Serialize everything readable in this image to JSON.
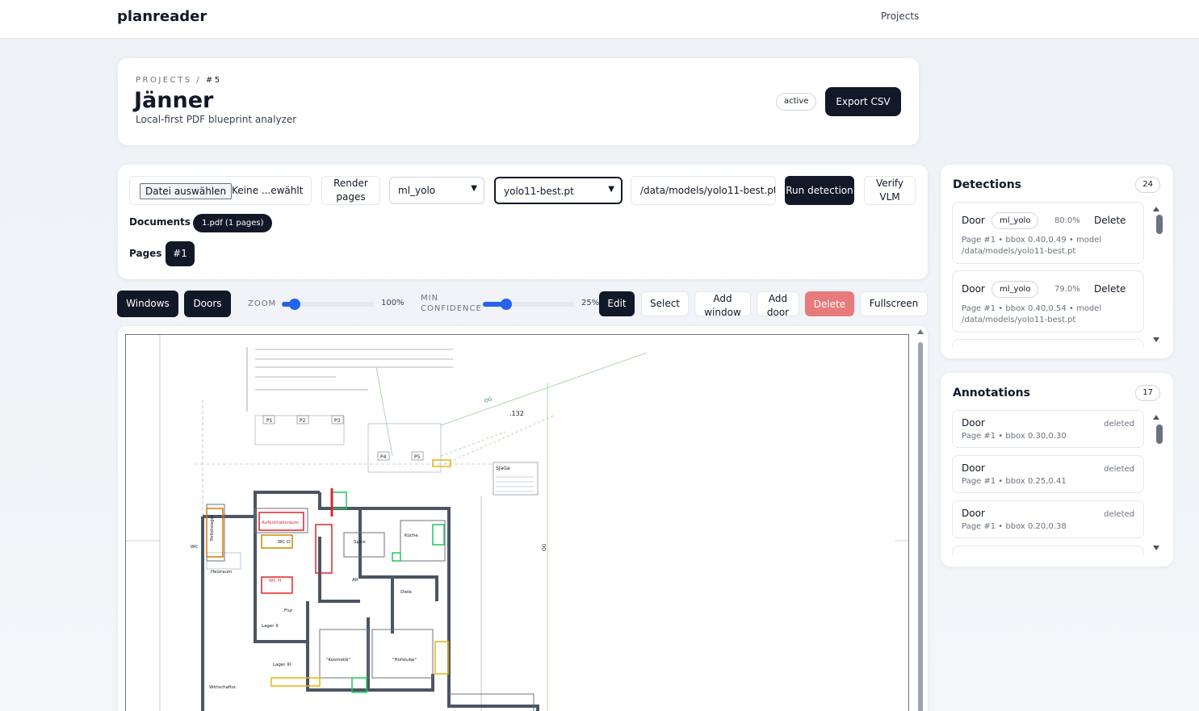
{
  "app": {
    "brand": "planreader",
    "nav_projects": "Projects"
  },
  "breadcrumb": {
    "root": "PROJECTS",
    "separator": "/",
    "current": "#5"
  },
  "project": {
    "title": "Jänner",
    "subtitle": "Local-first PDF blueprint analyzer",
    "status": "active",
    "export_label": "Export CSV"
  },
  "toolbar": {
    "file_button": "Datei auswählen",
    "file_name": "Keine ...ewählt",
    "render_label": "Render pages",
    "detector_value": "ml_yolo",
    "model_value": "yolo11-best.pt",
    "model_path": "/data/models/yolo11-best.pt",
    "run_label": "Run detection",
    "verify_label": "Verify VLM",
    "documents_label": "Documents",
    "document_pill": "1.pdf (1 pages)",
    "pages_label": "Pages",
    "page_pill": "#1"
  },
  "controls": {
    "windows_label": "Windows",
    "doors_label": "Doors",
    "zoom_label": "ZOOM",
    "zoom_value": 100,
    "zoom_text": "100%",
    "min_conf_label": "MIN CONFIDENCE",
    "min_conf_value": 25,
    "min_conf_text": "25%",
    "edit_label": "Edit",
    "select_label": "Select",
    "add_window_label": "Add window",
    "add_door_label": "Add door",
    "delete_label": "Delete",
    "fullscreen_label": "Fullscreen"
  },
  "blueprint": {
    "number_label": ".132",
    "label_og": "OG",
    "room_p1": "P1",
    "room_p2": "P2",
    "room_p3": "P3",
    "room_p4": "P4",
    "room_p5": "P5",
    "legend_title": "SJaGa",
    "room_aufenthalt": "Aufenthaltsraum",
    "room_kueche": "Küche",
    "room_speis": "Speis",
    "room_heizraum": "Heizraum",
    "room_diele": "Diele",
    "room_ar": "AR",
    "room_flur": "Flur",
    "room_lager2": "Lager II",
    "room_lager3": "Lager III",
    "room_wc": "WC",
    "room_wc_d": "WC D",
    "room_wc_h": "WC H",
    "room_kosmetik": "\"Kosmetik\"",
    "room_hofstube": "\"Hofstube\"",
    "room_wirtschaft": "Wirtschaftsr.",
    "room_pellets": "Pelletslager"
  },
  "detections": {
    "title": "Detections",
    "count": "24",
    "items": [
      {
        "label": "Door",
        "model": "ml_yolo",
        "confidence": "80.0%",
        "delete": "Delete",
        "meta": "Page #1 • bbox 0.40,0.49 • model /data/models/yolo11-best.pt"
      },
      {
        "label": "Door",
        "model": "ml_yolo",
        "confidence": "79.0%",
        "delete": "Delete",
        "meta": "Page #1 • bbox 0.40,0.54 • model /data/models/yolo11-best.pt"
      }
    ]
  },
  "annotations": {
    "title": "Annotations",
    "count": "17",
    "items": [
      {
        "label": "Door",
        "status": "deleted",
        "meta": "Page #1 • bbox 0.30,0.30"
      },
      {
        "label": "Door",
        "status": "deleted",
        "meta": "Page #1 • bbox 0.25,0.41"
      },
      {
        "label": "Door",
        "status": "deleted",
        "meta": "Page #1 • bbox 0.20,0.38"
      }
    ]
  },
  "colors": {
    "primary": "#111827",
    "accent": "#2563eb",
    "danger": "#e77b7b"
  }
}
